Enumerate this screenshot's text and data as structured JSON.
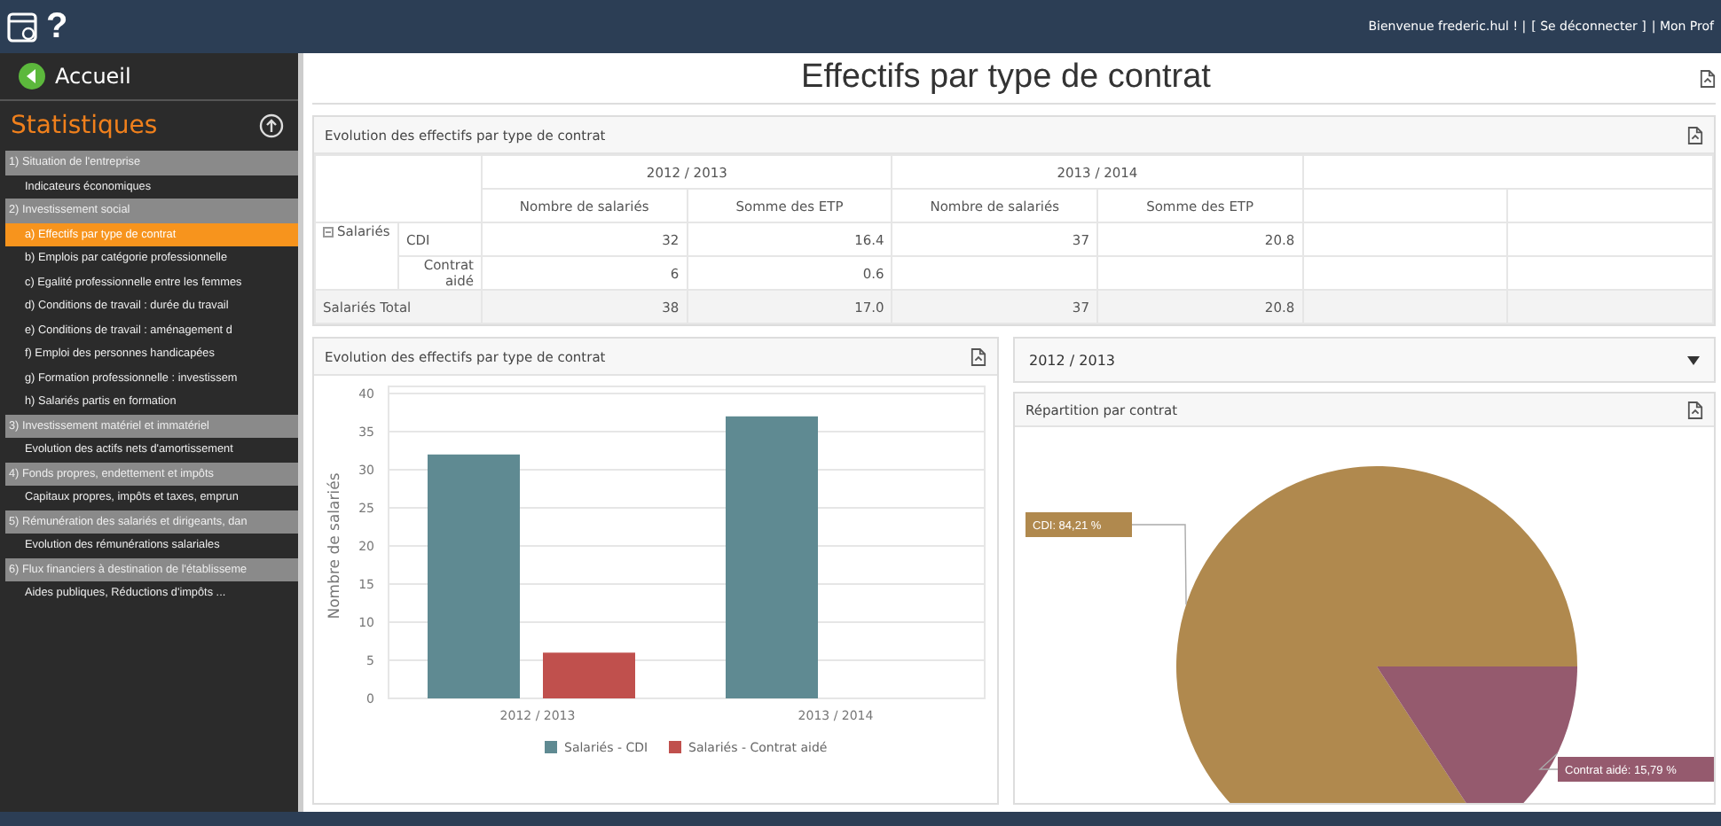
{
  "topbar": {
    "help": "?",
    "welcome": "Bienvenue frederic.hul ! |",
    "logout": "[ Se déconnecter ]",
    "profile": "| Mon Prof"
  },
  "sidebar": {
    "home": "Accueil",
    "heading": "Statistiques",
    "items": [
      {
        "kind": "section",
        "label": "1) Situation de l'entreprise",
        "selected": false
      },
      {
        "kind": "link",
        "label": "Indicateurs économiques",
        "selected": false
      },
      {
        "kind": "section",
        "label": "2) Investissement social",
        "selected": false
      },
      {
        "kind": "link",
        "label": "a) Effectifs par type de contrat",
        "selected": true
      },
      {
        "kind": "link",
        "label": "b) Emplois par catégorie professionnelle",
        "selected": false
      },
      {
        "kind": "link",
        "label": "c) Egalité professionnelle entre les femmes",
        "selected": false
      },
      {
        "kind": "link",
        "label": "d) Conditions de travail : durée du travail",
        "selected": false
      },
      {
        "kind": "link",
        "label": "e) Conditions de travail : aménagement d",
        "selected": false
      },
      {
        "kind": "link",
        "label": "f) Emploi des personnes handicapées",
        "selected": false
      },
      {
        "kind": "link",
        "label": "g) Formation professionnelle : investissem",
        "selected": false
      },
      {
        "kind": "link",
        "label": "h) Salariés partis en formation",
        "selected": false
      },
      {
        "kind": "section",
        "label": "3) Investissement matériel et immatériel",
        "selected": false
      },
      {
        "kind": "link",
        "label": "Evolution des actifs nets d'amortissement",
        "selected": false
      },
      {
        "kind": "section",
        "label": "4) Fonds propres, endettement et impôts",
        "selected": false
      },
      {
        "kind": "link",
        "label": "Capitaux propres, impôts et taxes, emprun",
        "selected": false
      },
      {
        "kind": "section",
        "label": "5) Rémunération des salariés et dirigeants, dan",
        "selected": false
      },
      {
        "kind": "link",
        "label": "Evolution des rémunérations salariales",
        "selected": false
      },
      {
        "kind": "section",
        "label": "6) Flux financiers à destination de l'établisseme",
        "selected": false
      },
      {
        "kind": "link",
        "label": "Aides publiques, Réductions d'impôts ...",
        "selected": false
      }
    ]
  },
  "page_title": "Effectifs par type de contrat",
  "table": {
    "title": "Evolution des effectifs par type de contrat",
    "groups": [
      "2012 / 2013",
      "2013 / 2014"
    ],
    "columns": [
      "Nombre de salariés",
      "Somme des ETP",
      "Nombre de salariés",
      "Somme des ETP"
    ],
    "rows": [
      {
        "kind": "detail",
        "group": "Salariés",
        "label": "CDI",
        "values": [
          "32",
          "16.4",
          "37",
          "20.8"
        ]
      },
      {
        "kind": "detail",
        "label": "Contrat aidé",
        "values": [
          "6",
          "0.6"
        ]
      },
      {
        "kind": "total",
        "label": "Salariés Total",
        "values": [
          "38",
          "17.0",
          "37",
          "20.8"
        ]
      }
    ]
  },
  "bar_panel": {
    "title": "Evolution des effectifs par type de contrat",
    "chart_data": {
      "type": "bar",
      "ylabel": "Nombre de salariés",
      "categories": [
        "2012 / 2013",
        "2013 / 2014"
      ],
      "series": [
        {
          "name": "Salariés - CDI",
          "color": "#5f8a92",
          "values": [
            32,
            37
          ]
        },
        {
          "name": "Salariés - Contrat aidé",
          "color": "#c0504d",
          "values": [
            6,
            null
          ]
        }
      ],
      "ylim": [
        0,
        40
      ],
      "yticks": [
        0,
        5,
        10,
        15,
        20,
        25,
        30,
        35,
        40
      ],
      "grid": true,
      "legend": "bottom"
    }
  },
  "period_select": {
    "value": "2012 / 2013"
  },
  "pie_panel": {
    "title": "Répartition par contrat",
    "chart_data": {
      "type": "pie",
      "values": [
        84.21,
        15.79
      ],
      "colors": [
        "#b0894e",
        "#955a6e"
      ],
      "value_labels": [
        "CDI: 84,21 %",
        "Contrat aidé: 15,79 %"
      ]
    }
  }
}
